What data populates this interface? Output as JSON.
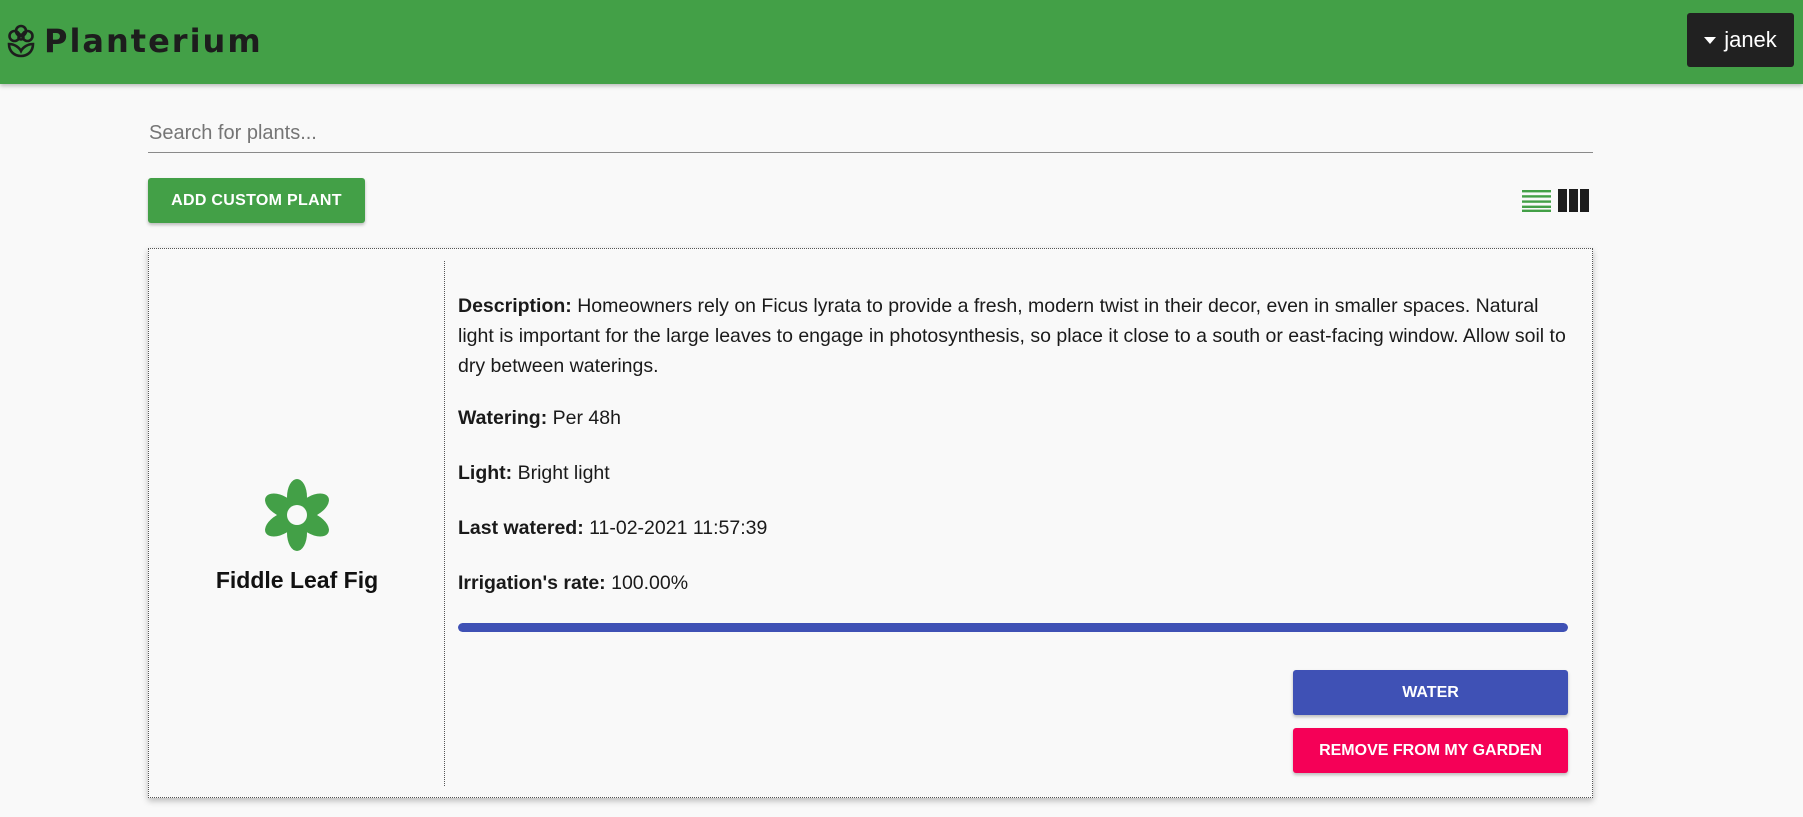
{
  "app": {
    "title": "Planterium",
    "brand_icon": "flower-icon",
    "user_menu": {
      "username": "janek",
      "icon": "caret-down-icon"
    }
  },
  "search": {
    "placeholder": "Search for plants...",
    "value": ""
  },
  "toolbar": {
    "add_label": "ADD CUSTOM PLANT",
    "views": [
      {
        "name": "list-view-icon",
        "active": true
      },
      {
        "name": "grid-view-icon",
        "active": false
      }
    ]
  },
  "plant": {
    "name": "Fiddle Leaf Fig",
    "icon": "flower-icon",
    "description_label": "Description:",
    "description": "Homeowners rely on Ficus lyrata to provide a fresh, modern twist in their decor, even in smaller spaces. Natural light is important for the large leaves to engage in photosynthesis, so place it close to a south or east-facing window. Allow soil to dry between waterings.",
    "watering_label": "Watering:",
    "watering": "Per 48h",
    "light_label": "Light:",
    "light": "Bright light",
    "last_watered_label": "Last watered:",
    "last_watered": "11-02-2021 11:57:39",
    "irrigation_label": "Irrigation's rate:",
    "irrigation": "100.00%",
    "irrigation_fraction": 1.0,
    "water_label": "WATER",
    "remove_label": "REMOVE FROM MY GARDEN"
  },
  "colors": {
    "topbar": "#43a047",
    "accent_green": "#43a047",
    "primary": "#3f51b5",
    "danger": "#f50057",
    "user_menu_bg": "#212121",
    "background": "#f9f9f9"
  }
}
